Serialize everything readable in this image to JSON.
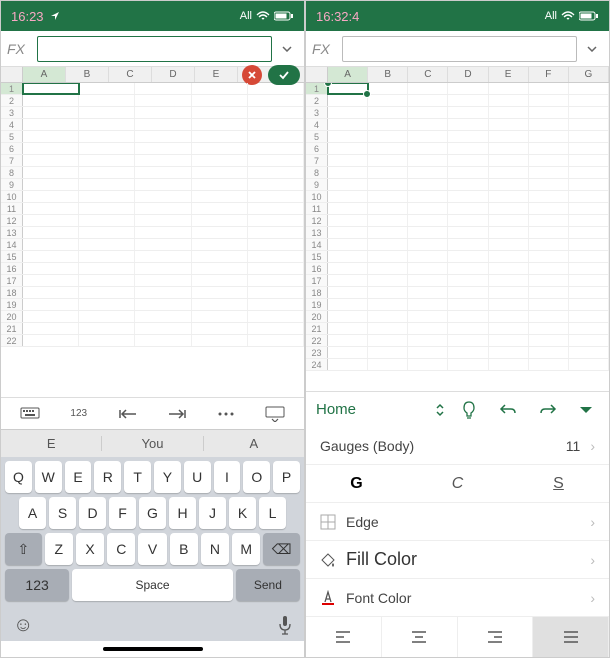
{
  "left": {
    "status": {
      "time": "16:23",
      "carrier": "All"
    },
    "fx": "FX",
    "cols": [
      "A",
      "B",
      "C",
      "D",
      "E"
    ],
    "rowCount": 22,
    "suggestions": [
      "E",
      "You",
      "A"
    ],
    "keyboard": {
      "r1": [
        "Q",
        "W",
        "E",
        "R",
        "T",
        "Y",
        "U",
        "I",
        "O",
        "P"
      ],
      "r2": [
        "A",
        "S",
        "D",
        "F",
        "G",
        "H",
        "J",
        "K",
        "L"
      ],
      "r3_shift": "⇧",
      "r3": [
        "Z",
        "X",
        "C",
        "V",
        "B",
        "N",
        "M"
      ],
      "r3_del": "⌫",
      "num": "123",
      "space": "Space",
      "send": "Send"
    },
    "toolbar_nums": "123"
  },
  "right": {
    "status": {
      "time": "16:32:4",
      "carrier": "All"
    },
    "fx": "FX",
    "cols": [
      "A",
      "B",
      "C",
      "D",
      "E",
      "F",
      "G"
    ],
    "rowCount": 24,
    "panel": {
      "home": "Home",
      "font_row": {
        "label": "Gauges (Body)",
        "value": "11"
      },
      "bold": "G",
      "italic": "C",
      "underline": "S",
      "edge": "Edge",
      "fill": "Fill Color",
      "font": "Font Color"
    }
  }
}
